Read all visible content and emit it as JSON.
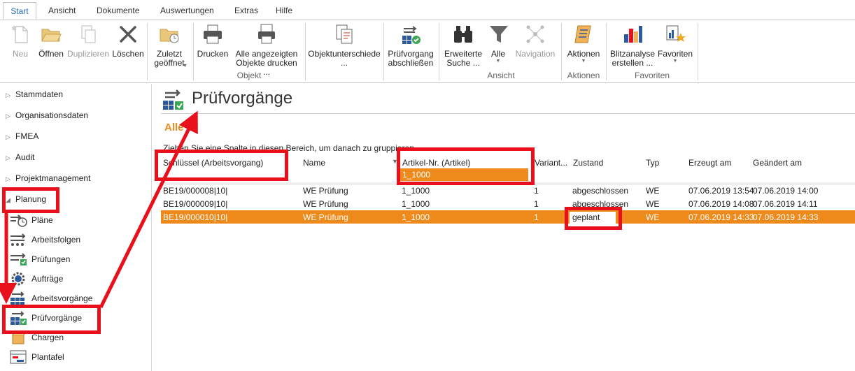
{
  "tabs": [
    "Start",
    "Ansicht",
    "Dokumente",
    "Auswertungen",
    "Extras",
    "Hilfe"
  ],
  "ribbon": {
    "buttons": [
      {
        "label": "Neu",
        "icon": "new-document-icon",
        "disabled": true
      },
      {
        "label": "Öffnen",
        "icon": "folder-open-icon",
        "disabled": false
      },
      {
        "label": "Duplizieren",
        "icon": "duplicate-icon",
        "disabled": true
      },
      {
        "label": "Löschen",
        "icon": "delete-x-icon",
        "disabled": false
      },
      {
        "label": "Zuletzt geöffnet",
        "icon": "recent-folder-icon",
        "disabled": false
      },
      {
        "label": "Drucken",
        "icon": "printer-icon",
        "disabled": false
      },
      {
        "label": "Alle angezeigten Objekte drucken ...",
        "icon": "print-all-icon",
        "disabled": false
      },
      {
        "label": "Objektunterschiede ...",
        "icon": "compare-documents-icon",
        "disabled": false
      },
      {
        "label": "Prüfvorgang abschließen",
        "icon": "close-inspection-icon",
        "disabled": false
      },
      {
        "label": "Erweiterte Suche ...",
        "icon": "binoculars-icon",
        "disabled": false
      },
      {
        "label": "Alle",
        "icon": "filter-icon",
        "disabled": false
      },
      {
        "label": "Navigation",
        "icon": "navigation-network-icon",
        "disabled": true
      },
      {
        "label": "Aktionen",
        "icon": "actions-scroll-icon",
        "disabled": false
      },
      {
        "label": "Blitzanalyse erstellen ...",
        "icon": "chart-icon",
        "disabled": false
      },
      {
        "label": "Favoriten",
        "icon": "favorites-star-icon",
        "disabled": false
      }
    ],
    "groups": {
      "objekt": "Objekt",
      "ansicht": "Ansicht",
      "aktionen": "Aktionen",
      "favoriten": "Favoriten"
    }
  },
  "sidebar": {
    "top_items": [
      "Stammdaten",
      "Organisationsdaten",
      "FMEA",
      "Audit",
      "Projektmanagement"
    ],
    "expanded": "Planung",
    "sub_items": [
      "Pläne",
      "Arbeitsfolgen",
      "Prüfungen",
      "Aufträge",
      "Arbeitsvorgänge",
      "Prüfvorgänge",
      "Chargen",
      "Plantafel"
    ]
  },
  "main": {
    "title": "Prüfvorgänge",
    "filter": "Alle",
    "group_hint": "Ziehen Sie eine Spalte in diesen Bereich, um danach zu gruppieren",
    "columns": [
      "Schlüssel (Arbeitsvorgang)",
      "Name",
      "Artikel-Nr. (Artikel)",
      "Variant...",
      "Zustand",
      "Typ",
      "Erzeugt am",
      "Geändert am"
    ],
    "filter_value": "1_1000",
    "rows": [
      [
        "BE19/000008|10|",
        "WE Prüfung",
        "1_1000",
        "1",
        "abgeschlossen",
        "WE",
        "07.06.2019  13:54",
        "07.06.2019  14:00"
      ],
      [
        "BE19/000009|10|",
        "WE Prüfung",
        "1_1000",
        "1",
        "abgeschlossen",
        "WE",
        "07.06.2019  14:08",
        "07.06.2019  14:11"
      ],
      [
        "BE19/000010|10|",
        "WE Prüfung",
        "1_1000",
        "1",
        "geplant",
        "WE",
        "07.06.2019  14:33",
        "07.06.2019  14:33"
      ]
    ]
  },
  "colors": {
    "accent": "#ee8a1c",
    "link": "#2a6ebb",
    "annotation": "#e8101b"
  }
}
